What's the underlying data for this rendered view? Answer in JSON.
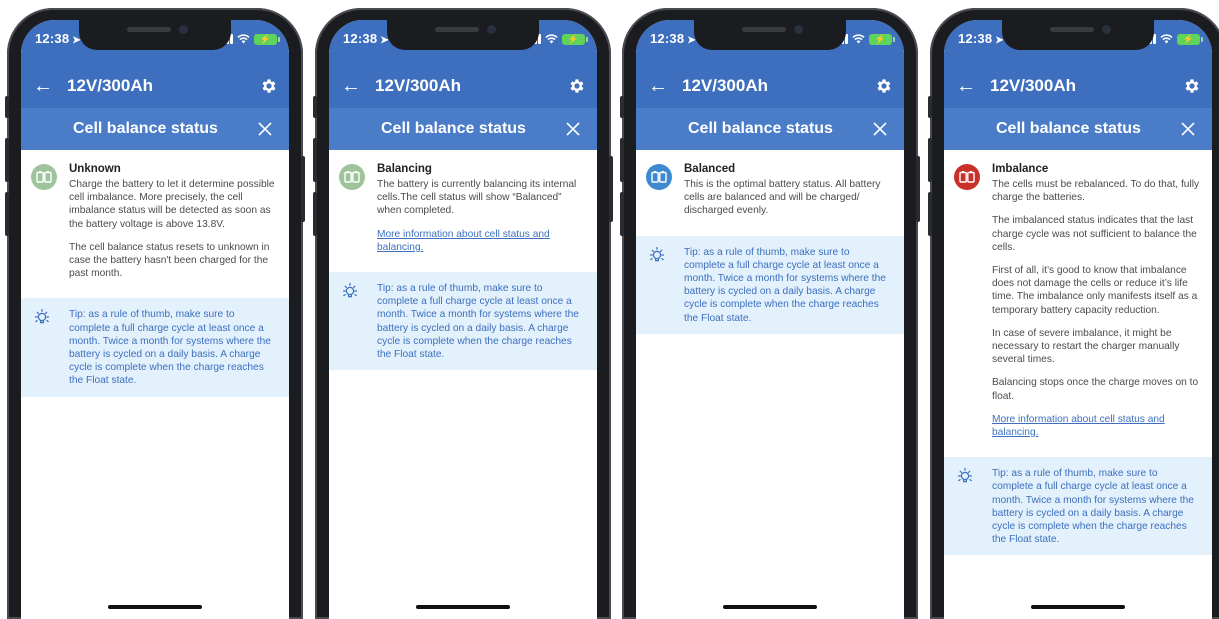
{
  "status_bar": {
    "time": "12:38",
    "location_glyph": "➤"
  },
  "top_bar": {
    "back_glyph": "←",
    "title": "12V/300Ah"
  },
  "modal": {
    "title": "Cell balance status",
    "close_glyph": "✕"
  },
  "tip_text": "Tip: as a rule of thumb, make sure to complete a full charge cycle at least once a month. Twice a month for systems where the battery is cycled on a daily basis. A charge cycle is complete when the charge reaches the Float state.",
  "link_text": "More information about cell status and balancing.",
  "colors": {
    "header": "#3d6fbe",
    "modal_header": "#4a7cc8",
    "tip_bg": "#e3f1fc",
    "unknown": "#9fc49b",
    "balancing": "#9fc49b",
    "balanced": "#3e89d0",
    "imbalance": "#c8312a"
  },
  "phones": [
    {
      "status": "Unknown",
      "icon": "battery-unknown-icon",
      "paragraphs": [
        "Charge the battery to let it determine possible cell imbalance. More precisely, the cell imbalance status will be detected as soon as the battery voltage is above 13.8V.",
        "The cell balance status resets to unknown in case the battery hasn't been charged for the past month."
      ],
      "has_link": false
    },
    {
      "status": "Balancing",
      "icon": "battery-balancing-icon",
      "paragraphs": [
        "The battery is currently balancing its internal cells.The cell status will show “Balanced” when completed."
      ],
      "has_link": true
    },
    {
      "status": "Balanced",
      "icon": "battery-balanced-icon",
      "paragraphs": [
        "This is the optimal battery status. All battery cells are balanced and will be charged/ discharged evenly."
      ],
      "has_link": false
    },
    {
      "status": "Imbalance",
      "icon": "battery-imbalance-icon",
      "paragraphs": [
        "The cells must be rebalanced. To do that, fully charge the batteries.",
        "The imbalanced status indicates that the last charge cycle was not sufficient to balance the cells.",
        "First of all, it’s good to know that imbalance does not damage the cells or reduce it’s life time. The imbalance only manifests itself as a temporary battery capacity reduction.",
        "In case of severe imbalance, it might be necessary to restart the charger manually several times.",
        "Balancing stops once the charge moves on to float."
      ],
      "has_link": true
    }
  ]
}
